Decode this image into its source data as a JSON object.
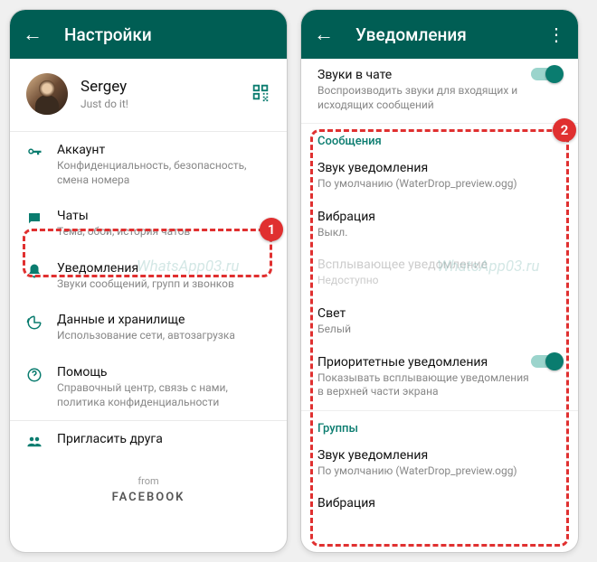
{
  "left": {
    "title": "Настройки",
    "profile": {
      "name": "Sergey",
      "status": "Just do it!"
    },
    "items": {
      "account": {
        "label": "Аккаунт",
        "sub": "Конфиденциальность, безопасность, смена номера"
      },
      "chats": {
        "label": "Чаты",
        "sub": "Тема, обои, история чатов"
      },
      "notif": {
        "label": "Уведомления",
        "sub": "Звуки сообщений, групп и звонков"
      },
      "data": {
        "label": "Данные и хранилище",
        "sub": "Использование сети, автозагрузка"
      },
      "help": {
        "label": "Помощь",
        "sub": "Справочный центр, связь с нами, политика конфиденциальности"
      },
      "invite": {
        "label": "Пригласить друга"
      }
    },
    "footer": {
      "from": "from",
      "brand": "FACEBOOK"
    },
    "badge": "1"
  },
  "right": {
    "title": "Уведомления",
    "chat_sounds": {
      "label": "Звуки в чате",
      "sub": "Воспроизводить звуки для входящих и исходящих сообщений"
    },
    "sections": {
      "messages": "Сообщения",
      "groups": "Группы"
    },
    "msg": {
      "sound": {
        "label": "Звук уведомления",
        "sub": "По умолчанию (WaterDrop_preview.ogg)"
      },
      "vibrate": {
        "label": "Вибрация",
        "sub": "Выкл."
      },
      "popup": {
        "label": "Всплывающее уведомление",
        "sub": "Недоступно"
      },
      "light": {
        "label": "Свет",
        "sub": "Белый"
      },
      "priority": {
        "label": "Приоритетные уведомления",
        "sub": "Показывать всплывающие уведомления в верхней части экрана"
      }
    },
    "grp": {
      "sound": {
        "label": "Звук уведомления",
        "sub": "По умолчанию (WaterDrop_preview.ogg)"
      },
      "vibrate": {
        "label": "Вибрация"
      }
    },
    "badge": "2"
  },
  "watermark": "WhatsApp03.ru"
}
